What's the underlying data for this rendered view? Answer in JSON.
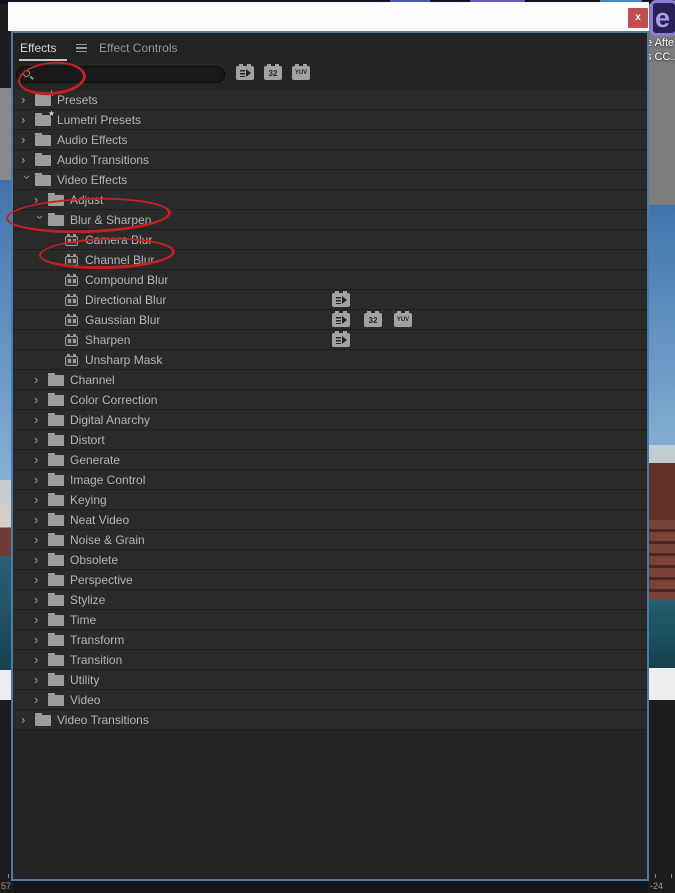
{
  "window": {
    "close_button": "x"
  },
  "panel": {
    "tabs": [
      {
        "label": "Effects",
        "active": true
      },
      {
        "label": "Effect Controls",
        "active": false
      }
    ],
    "search": {
      "placeholder": "",
      "value": ""
    },
    "toolbar_badges": {
      "accelerated": "accelerated-effects",
      "bit32": "32",
      "yuv": "YUV"
    },
    "tree": {
      "items": [
        {
          "label": "Presets",
          "level": 0,
          "kind": "folder",
          "expanded": false,
          "star": true
        },
        {
          "label": "Lumetri Presets",
          "level": 0,
          "kind": "folder",
          "expanded": false,
          "star": true
        },
        {
          "label": "Audio Effects",
          "level": 0,
          "kind": "folder",
          "expanded": false
        },
        {
          "label": "Audio Transitions",
          "level": 0,
          "kind": "folder",
          "expanded": false
        },
        {
          "label": "Video Effects",
          "level": 0,
          "kind": "folder",
          "expanded": true,
          "annotated": true
        },
        {
          "label": "Adjust",
          "level": 1,
          "kind": "folder",
          "expanded": false
        },
        {
          "label": "Blur & Sharpen",
          "level": 1,
          "kind": "folder",
          "expanded": true,
          "annotated": true
        },
        {
          "label": "Camera Blur",
          "level": 2,
          "kind": "effect",
          "badges": []
        },
        {
          "label": "Channel Blur",
          "level": 2,
          "kind": "effect",
          "badges": []
        },
        {
          "label": "Compound Blur",
          "level": 2,
          "kind": "effect",
          "badges": []
        },
        {
          "label": "Directional Blur",
          "level": 2,
          "kind": "effect",
          "badges": [
            "accelerated"
          ]
        },
        {
          "label": "Gaussian Blur",
          "level": 2,
          "kind": "effect",
          "badges": [
            "accelerated",
            "bit32",
            "yuv"
          ]
        },
        {
          "label": "Sharpen",
          "level": 2,
          "kind": "effect",
          "badges": [
            "accelerated"
          ]
        },
        {
          "label": "Unsharp Mask",
          "level": 2,
          "kind": "effect",
          "badges": []
        },
        {
          "label": "Channel",
          "level": 1,
          "kind": "folder",
          "expanded": false
        },
        {
          "label": "Color Correction",
          "level": 1,
          "kind": "folder",
          "expanded": false
        },
        {
          "label": "Digital Anarchy",
          "level": 1,
          "kind": "folder",
          "expanded": false
        },
        {
          "label": "Distort",
          "level": 1,
          "kind": "folder",
          "expanded": false
        },
        {
          "label": "Generate",
          "level": 1,
          "kind": "folder",
          "expanded": false
        },
        {
          "label": "Image Control",
          "level": 1,
          "kind": "folder",
          "expanded": false
        },
        {
          "label": "Keying",
          "level": 1,
          "kind": "folder",
          "expanded": false
        },
        {
          "label": "Neat Video",
          "level": 1,
          "kind": "folder",
          "expanded": false
        },
        {
          "label": "Noise & Grain",
          "level": 1,
          "kind": "folder",
          "expanded": false
        },
        {
          "label": "Obsolete",
          "level": 1,
          "kind": "folder",
          "expanded": false
        },
        {
          "label": "Perspective",
          "level": 1,
          "kind": "folder",
          "expanded": false
        },
        {
          "label": "Stylize",
          "level": 1,
          "kind": "folder",
          "expanded": false
        },
        {
          "label": "Time",
          "level": 1,
          "kind": "folder",
          "expanded": false
        },
        {
          "label": "Transform",
          "level": 1,
          "kind": "folder",
          "expanded": false
        },
        {
          "label": "Transition",
          "level": 1,
          "kind": "folder",
          "expanded": false
        },
        {
          "label": "Utility",
          "level": 1,
          "kind": "folder",
          "expanded": false
        },
        {
          "label": "Video",
          "level": 1,
          "kind": "folder",
          "expanded": false
        },
        {
          "label": "Video Transitions",
          "level": 0,
          "kind": "folder",
          "expanded": false
        }
      ]
    }
  },
  "desktop": {
    "ae_icon_letter": "e",
    "ae_label_line1": "e Afte",
    "ae_label_line2": "s CC..",
    "meter_left": "57",
    "meter_right": "-24"
  },
  "colors": {
    "annotation_red": "#c32020",
    "panel_border_blue": "#4a7ca6",
    "close_button_red": "#c0504f"
  }
}
